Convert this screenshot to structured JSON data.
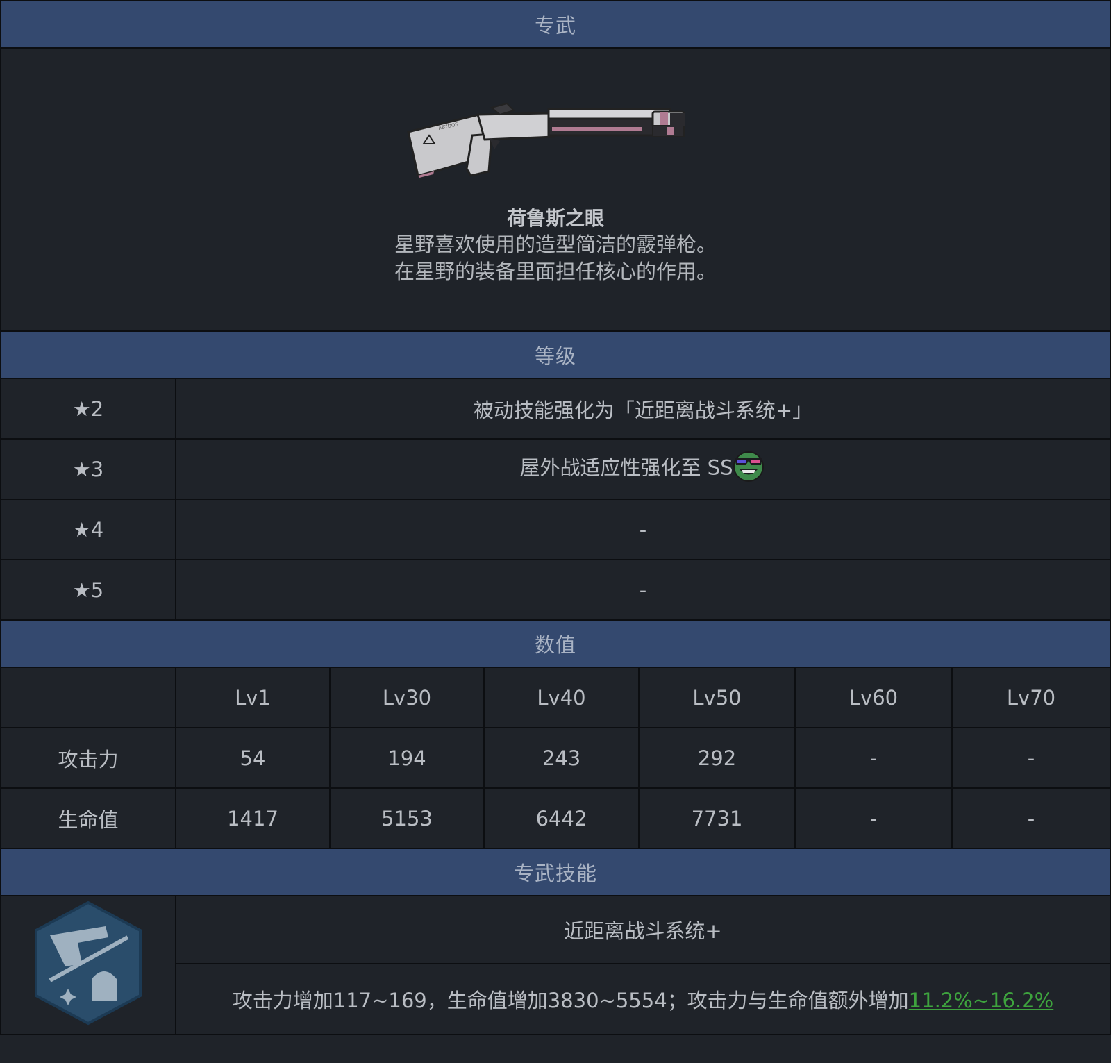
{
  "weapon_section": {
    "header": "专武",
    "name": "荷鲁斯之眼",
    "desc_line1": "星野喜欢使用的造型简洁的霰弹枪。",
    "desc_line2": "在星野的装备里面担任核心的作用。",
    "gun_engraving": "ABYDOS"
  },
  "grade_section": {
    "header": "等级",
    "rows": [
      {
        "star": "★2",
        "effect": "被动技能强化为「近距离战斗系统+」"
      },
      {
        "star": "★3",
        "effect": "屋外战适应性强化至 SS"
      },
      {
        "star": "★4",
        "effect": "-"
      },
      {
        "star": "★5",
        "effect": "-"
      }
    ],
    "ss_emoji_icon": "sunglasses-grin-icon"
  },
  "stats_section": {
    "header": "数值",
    "levels": [
      "Lv1",
      "Lv30",
      "Lv40",
      "Lv50",
      "Lv60",
      "Lv70"
    ],
    "rows": [
      {
        "label": "攻击力",
        "values": [
          "54",
          "194",
          "243",
          "292",
          "-",
          "-"
        ]
      },
      {
        "label": "生命值",
        "values": [
          "1417",
          "5153",
          "6442",
          "7731",
          "-",
          "-"
        ]
      }
    ]
  },
  "skill_section": {
    "header": "专武技能",
    "skill_name": "近距离战斗系统+",
    "desc_prefix": "攻击力增加117~169，生命值增加3830~5554；攻击力与生命值额外增加",
    "desc_highlight": "11.2%~16.2%",
    "icon": "pistol-shield-skill-icon"
  },
  "colors": {
    "header_bg": "#34496f",
    "cell_bg": "#1f2329",
    "border": "#0c0e11",
    "highlight_green": "#3ea33e"
  }
}
